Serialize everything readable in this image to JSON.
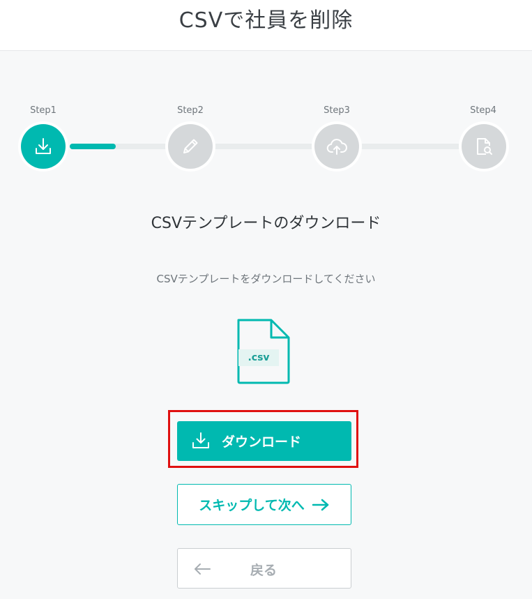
{
  "page": {
    "title": "CSVで社員を削除"
  },
  "stepper": {
    "steps": [
      {
        "label": "Step1",
        "icon": "download-icon",
        "state": "active"
      },
      {
        "label": "Step2",
        "icon": "pencil-icon",
        "state": "inactive"
      },
      {
        "label": "Step3",
        "icon": "cloud-upload-icon",
        "state": "inactive"
      },
      {
        "label": "Step4",
        "icon": "file-search-icon",
        "state": "inactive"
      }
    ],
    "progress": 0.25
  },
  "content": {
    "section_title": "CSVテンプレートのダウンロード",
    "description": "CSVテンプレートをダウンロードしてください",
    "file_icon": "csv-file-icon",
    "file_extension": ".csv"
  },
  "actions": {
    "download_label": "ダウンロード",
    "skip_label": "スキップして次へ",
    "back_label": "戻る"
  },
  "colors": {
    "accent": "#00b9b0",
    "inactive_step": "#d5d8da",
    "highlight_border": "#e01010",
    "background": "#f7f8f9"
  }
}
